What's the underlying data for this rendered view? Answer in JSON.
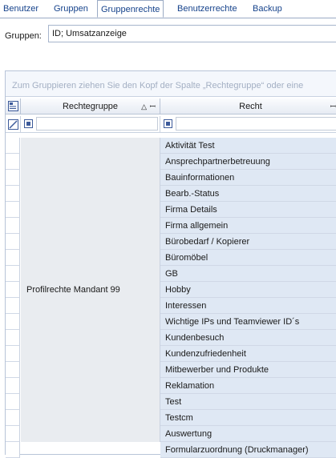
{
  "tabs": [
    {
      "label": "Benutzer"
    },
    {
      "label": "Gruppen"
    },
    {
      "label": "Gruppenrechte"
    },
    {
      "label": "Benutzerrechte"
    },
    {
      "label": "Backup"
    }
  ],
  "group_label": "Gruppen:",
  "group_value": "ID; Umsatzanzeige",
  "groupby_hint": "Zum Gruppieren ziehen Sie den Kopf der Spalte „Rechtegruppe“ oder eine",
  "columns": {
    "col1": "Rechtegruppe",
    "col2": "Recht"
  },
  "group_name": "Profilrechte Mandant 99",
  "rights": [
    "Aktivität Test",
    "Ansprechpartnerbetreuung",
    "Bauinformationen",
    "Bearb.-Status",
    "Firma Details",
    "Firma allgemein",
    "Bürobedarf / Kopierer",
    "Büromöbel",
    "GB",
    "Hobby",
    "Interessen",
    "Wichtige IPs und Teamviewer ID´s",
    "Kundenbesuch",
    "Kundenzufriedenheit",
    "Mitbewerber und Produkte",
    "Reklamation",
    "Test",
    "Testcm",
    "Auswertung",
    "Formularzuordnung (Druckmanager)"
  ]
}
